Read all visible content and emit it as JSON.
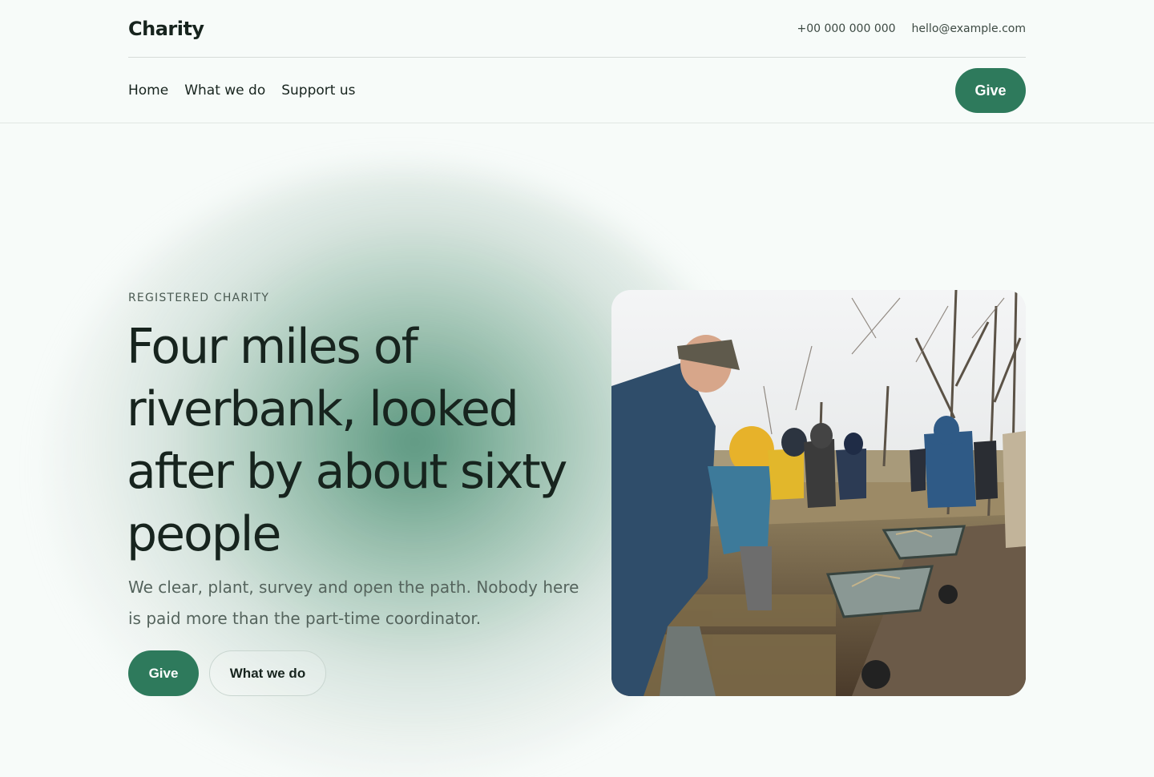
{
  "brand": {
    "name": "Charity"
  },
  "contact": {
    "phone": "+00 000 000 000",
    "email": "hello@example.com"
  },
  "nav": {
    "items": [
      "Home",
      "What we do",
      "Support us"
    ],
    "give_label": "Give"
  },
  "hero": {
    "eyebrow": "REGISTERED CHARITY",
    "headline": "Four miles of riverbank, looked after by about sixty people",
    "subcopy": "We clear, plant, survey and open the path. Nobody here is paid more than the part-time coordinator.",
    "primary_cta": "Give",
    "secondary_cta": "What we do"
  },
  "colors": {
    "accent": "#2e7a5c",
    "text": "#17241e",
    "muted": "#55645d",
    "background": "#f7fbf9"
  }
}
